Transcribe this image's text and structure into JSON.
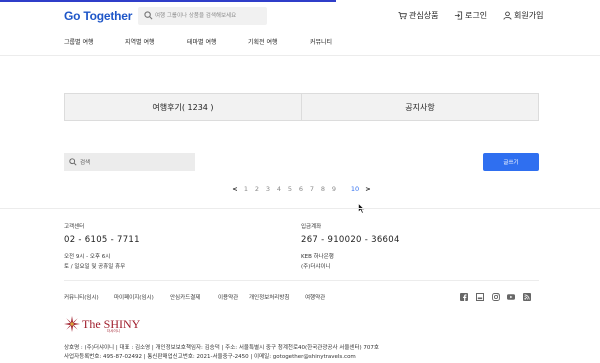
{
  "header": {
    "logo_text": "Go Together",
    "search_placeholder": "여행 그룹이나 상품을 검색해보세요",
    "user_menu": [
      "관심상품",
      "로그인",
      "회원가입"
    ]
  },
  "nav": [
    "그룹별 여행",
    "지역별 여행",
    "테마별 여행",
    "기획전 여행",
    "커뮤니티"
  ],
  "tabs": [
    "여행후기( 1234 )",
    "공지사항"
  ],
  "search": {
    "placeholder": "검색"
  },
  "write_button": "글쓰기",
  "pagination": {
    "prev": "<",
    "pages": [
      "1",
      "2",
      "3",
      "4",
      "5",
      "6",
      "7",
      "8",
      "9",
      "10"
    ],
    "active": "10",
    "next": ">"
  },
  "footer": {
    "customer_center": {
      "label": "고객센터",
      "phone": "02 - 6105 - 7711",
      "hours": "오전 9시 - 오후 6시",
      "holidays": "토 / 일요일 및 공휴일 휴무"
    },
    "deposit_account": {
      "label": "입금계좌",
      "account": "267 - 910020 - 36604",
      "bank": "KEB 하나은행",
      "holder": "(주)더샤이니"
    },
    "links": [
      "커뮤니티(임시)",
      "마이페이지(임시)",
      "안심카드결제",
      "이용약관",
      "개인정보처리방침",
      "여행약관"
    ],
    "social_icons": [
      "facebook-icon",
      "blog-icon",
      "instagram-icon",
      "youtube-icon",
      "rss-icon"
    ],
    "company_logo": "The SHINY",
    "company_logo_sub": "더샤이니",
    "business_info_1": "상호명 : (주)더샤이니 | 대표 : 김소영 | 개인정보보호책임자: 김승덕 | 주소: 서울특별시 중구 청계천로40(한국관광공사 서울센터) 707호",
    "business_info_2": "사업자등록번호: 495-87-02492 | 통신판매업신고번호: 2021-서울중구-2450 | 이메일: gotogether@shinytravels.com"
  },
  "colors": {
    "brand_blue": "#1e56c8",
    "button_blue": "#2f6ff0",
    "shiny_red": "#a01e2c"
  }
}
